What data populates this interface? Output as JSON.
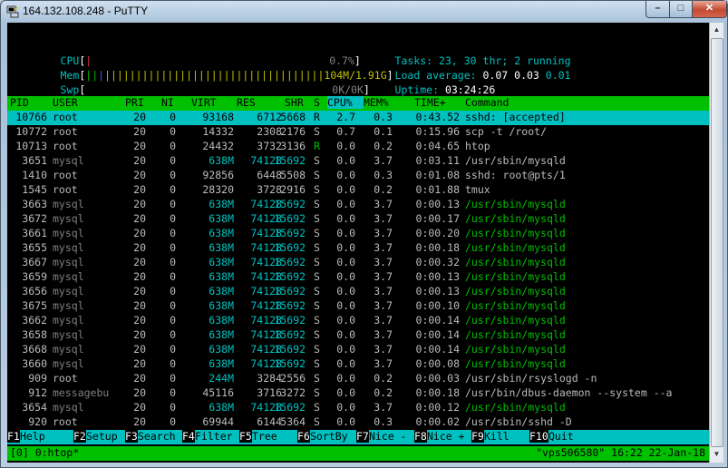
{
  "window": {
    "title": "164.132.108.248 - PuTTY",
    "min_glyph": "–",
    "max_glyph": "□",
    "close_glyph": "✕"
  },
  "meters": {
    "cpu": {
      "label": "CPU",
      "value": "0.7%"
    },
    "mem": {
      "label": "Mem",
      "value": "104M/1.91G"
    },
    "swp": {
      "label": "Swp",
      "value": "0K/0K"
    }
  },
  "summary": {
    "tasks_label": "Tasks:",
    "tasks": "23,",
    "thr": "30",
    "thr_label": "thr;",
    "running": "2",
    "running_label": "running",
    "load_label": "Load average:",
    "load1": "0.07",
    "load5": "0.03",
    "load15": "0.01",
    "uptime_label": "Uptime:",
    "uptime": "03:24:26"
  },
  "columns": [
    "PID",
    "USER",
    "PRI",
    "NI",
    "VIRT",
    "RES",
    "SHR",
    "S",
    "CPU%",
    "MEM%",
    "TIME+",
    "Command"
  ],
  "processes": [
    {
      "pid": "10766",
      "user": "root",
      "pri": "20",
      "ni": "0",
      "virt": "93168",
      "res": "6712",
      "shr": "5668",
      "s": "R",
      "cpu": "2.7",
      "mem": "0.3",
      "time": "0:43.52",
      "cmd": "sshd: [accepted]"
    },
    {
      "pid": "10772",
      "user": "root",
      "pri": "20",
      "ni": "0",
      "virt": "14332",
      "res": "2308",
      "shr": "2176",
      "s": "S",
      "cpu": "0.7",
      "mem": "0.1",
      "time": "0:15.96",
      "cmd": "scp -t /root/"
    },
    {
      "pid": "10713",
      "user": "root",
      "pri": "20",
      "ni": "0",
      "virt": "24432",
      "res": "3732",
      "shr": "3136",
      "s": "R",
      "cpu": "0.0",
      "mem": "0.2",
      "time": "0:04.65",
      "cmd": "htop"
    },
    {
      "pid": "3651",
      "user": "mysql",
      "pri": "20",
      "ni": "0",
      "virt": "638M",
      "res": "74128",
      "shr": "15692",
      "s": "S",
      "cpu": "0.0",
      "mem": "3.7",
      "time": "0:03.11",
      "cmd": "/usr/sbin/mysqld"
    },
    {
      "pid": "1410",
      "user": "root",
      "pri": "20",
      "ni": "0",
      "virt": "92856",
      "res": "6448",
      "shr": "5508",
      "s": "S",
      "cpu": "0.0",
      "mem": "0.3",
      "time": "0:01.08",
      "cmd": "sshd: root@pts/1"
    },
    {
      "pid": "1545",
      "user": "root",
      "pri": "20",
      "ni": "0",
      "virt": "28320",
      "res": "3728",
      "shr": "2916",
      "s": "S",
      "cpu": "0.0",
      "mem": "0.2",
      "time": "0:01.88",
      "cmd": "tmux"
    },
    {
      "pid": "3663",
      "user": "mysql",
      "pri": "20",
      "ni": "0",
      "virt": "638M",
      "res": "74128",
      "shr": "15692",
      "s": "S",
      "cpu": "0.0",
      "mem": "3.7",
      "time": "0:00.13",
      "cmd": "/usr/sbin/mysqld"
    },
    {
      "pid": "3672",
      "user": "mysql",
      "pri": "20",
      "ni": "0",
      "virt": "638M",
      "res": "74128",
      "shr": "15692",
      "s": "S",
      "cpu": "0.0",
      "mem": "3.7",
      "time": "0:00.17",
      "cmd": "/usr/sbin/mysqld"
    },
    {
      "pid": "3661",
      "user": "mysql",
      "pri": "20",
      "ni": "0",
      "virt": "638M",
      "res": "74128",
      "shr": "15692",
      "s": "S",
      "cpu": "0.0",
      "mem": "3.7",
      "time": "0:00.20",
      "cmd": "/usr/sbin/mysqld"
    },
    {
      "pid": "3655",
      "user": "mysql",
      "pri": "20",
      "ni": "0",
      "virt": "638M",
      "res": "74128",
      "shr": "15692",
      "s": "S",
      "cpu": "0.0",
      "mem": "3.7",
      "time": "0:00.18",
      "cmd": "/usr/sbin/mysqld"
    },
    {
      "pid": "3667",
      "user": "mysql",
      "pri": "20",
      "ni": "0",
      "virt": "638M",
      "res": "74128",
      "shr": "15692",
      "s": "S",
      "cpu": "0.0",
      "mem": "3.7",
      "time": "0:00.32",
      "cmd": "/usr/sbin/mysqld"
    },
    {
      "pid": "3659",
      "user": "mysql",
      "pri": "20",
      "ni": "0",
      "virt": "638M",
      "res": "74128",
      "shr": "15692",
      "s": "S",
      "cpu": "0.0",
      "mem": "3.7",
      "time": "0:00.13",
      "cmd": "/usr/sbin/mysqld"
    },
    {
      "pid": "3656",
      "user": "mysql",
      "pri": "20",
      "ni": "0",
      "virt": "638M",
      "res": "74128",
      "shr": "15692",
      "s": "S",
      "cpu": "0.0",
      "mem": "3.7",
      "time": "0:00.13",
      "cmd": "/usr/sbin/mysqld"
    },
    {
      "pid": "3675",
      "user": "mysql",
      "pri": "20",
      "ni": "0",
      "virt": "638M",
      "res": "74128",
      "shr": "15692",
      "s": "S",
      "cpu": "0.0",
      "mem": "3.7",
      "time": "0:00.10",
      "cmd": "/usr/sbin/mysqld"
    },
    {
      "pid": "3662",
      "user": "mysql",
      "pri": "20",
      "ni": "0",
      "virt": "638M",
      "res": "74128",
      "shr": "15692",
      "s": "S",
      "cpu": "0.0",
      "mem": "3.7",
      "time": "0:00.14",
      "cmd": "/usr/sbin/mysqld"
    },
    {
      "pid": "3658",
      "user": "mysql",
      "pri": "20",
      "ni": "0",
      "virt": "638M",
      "res": "74128",
      "shr": "15692",
      "s": "S",
      "cpu": "0.0",
      "mem": "3.7",
      "time": "0:00.14",
      "cmd": "/usr/sbin/mysqld"
    },
    {
      "pid": "3668",
      "user": "mysql",
      "pri": "20",
      "ni": "0",
      "virt": "638M",
      "res": "74128",
      "shr": "15692",
      "s": "S",
      "cpu": "0.0",
      "mem": "3.7",
      "time": "0:00.14",
      "cmd": "/usr/sbin/mysqld"
    },
    {
      "pid": "3660",
      "user": "mysql",
      "pri": "20",
      "ni": "0",
      "virt": "638M",
      "res": "74128",
      "shr": "15692",
      "s": "S",
      "cpu": "0.0",
      "mem": "3.7",
      "time": "0:00.08",
      "cmd": "/usr/sbin/mysqld"
    },
    {
      "pid": "909",
      "user": "root",
      "pri": "20",
      "ni": "0",
      "virt": "244M",
      "res": "3284",
      "shr": "2556",
      "s": "S",
      "cpu": "0.0",
      "mem": "0.2",
      "time": "0:00.03",
      "cmd": "/usr/sbin/rsyslogd -n"
    },
    {
      "pid": "912",
      "user": "messagebu",
      "pri": "20",
      "ni": "0",
      "virt": "45116",
      "res": "3716",
      "shr": "3272",
      "s": "S",
      "cpu": "0.0",
      "mem": "0.2",
      "time": "0:00.18",
      "cmd": "/usr/bin/dbus-daemon --system --a"
    },
    {
      "pid": "3654",
      "user": "mysql",
      "pri": "20",
      "ni": "0",
      "virt": "638M",
      "res": "74128",
      "shr": "15692",
      "s": "S",
      "cpu": "0.0",
      "mem": "3.7",
      "time": "0:00.12",
      "cmd": "/usr/sbin/mysqld"
    },
    {
      "pid": "920",
      "user": "root",
      "pri": "20",
      "ni": "0",
      "virt": "69944",
      "res": "6144",
      "shr": "5364",
      "s": "S",
      "cpu": "0.0",
      "mem": "0.3",
      "time": "0:00.02",
      "cmd": "/usr/sbin/sshd -D"
    }
  ],
  "fkeys": [
    {
      "key": "F1",
      "label": "Help"
    },
    {
      "key": "F2",
      "label": "Setup"
    },
    {
      "key": "F3",
      "label": "Search"
    },
    {
      "key": "F4",
      "label": "Filter"
    },
    {
      "key": "F5",
      "label": "Tree"
    },
    {
      "key": "F6",
      "label": "SortBy"
    },
    {
      "key": "F7",
      "label": "Nice -"
    },
    {
      "key": "F8",
      "label": "Nice +"
    },
    {
      "key": "F9",
      "label": "Kill"
    },
    {
      "key": "F10",
      "label": "Quit"
    }
  ],
  "tmux": {
    "left": "[0] 0:htop*",
    "right": "\"vps506580\" 16:22 22-Jan-18"
  },
  "colors": {
    "cyan": "#00c0c0",
    "green": "#00c000",
    "yellow": "#c0c000",
    "blue": "#3a5cff",
    "red": "#e03030"
  }
}
